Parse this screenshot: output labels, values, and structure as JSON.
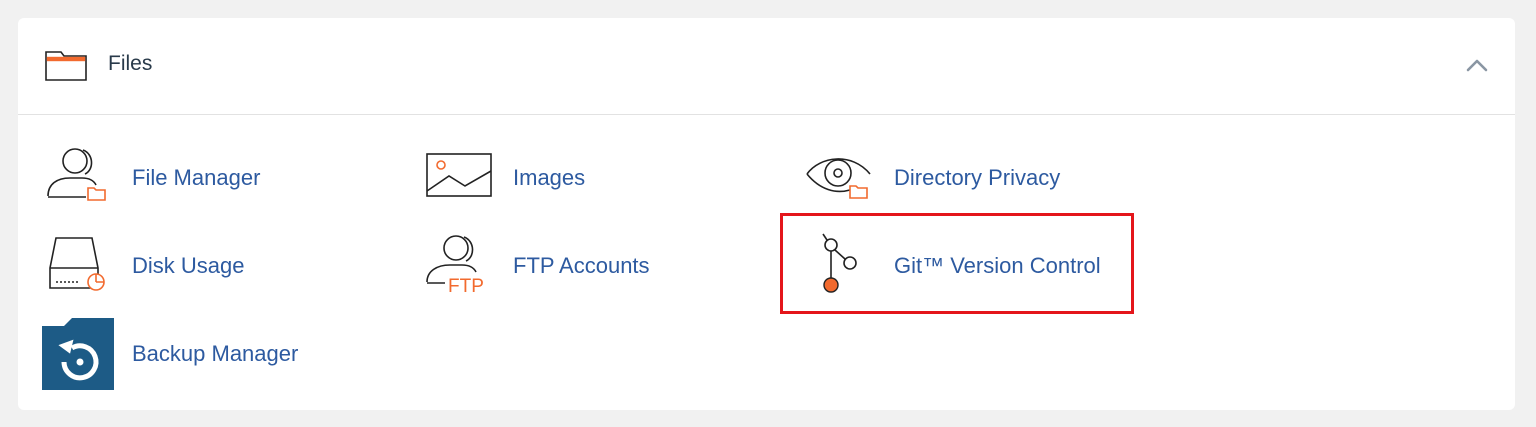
{
  "panel": {
    "title": "Files",
    "icons": {
      "header": "folder-icon",
      "toggle": "chevron-up-icon"
    },
    "items": [
      {
        "label": "File Manager",
        "icon": "file-manager-icon"
      },
      {
        "label": "Images",
        "icon": "image-icon"
      },
      {
        "label": "Directory Privacy",
        "icon": "eye-folder-icon"
      },
      {
        "label": "Disk Usage",
        "icon": "disk-usage-icon"
      },
      {
        "label": "FTP Accounts",
        "icon": "ftp-user-icon",
        "icon_text": "FTP"
      },
      {
        "label": "Git™ Version Control",
        "icon": "git-branch-icon"
      },
      {
        "label": "Backup Manager",
        "icon": "backup-restore-icon"
      }
    ]
  },
  "colors": {
    "link": "#2d5aa0",
    "accent": "#f26a2e",
    "backup_tile": "#1d5b86",
    "highlight": "#e4161b",
    "page_bg": "#f1f1f1"
  }
}
